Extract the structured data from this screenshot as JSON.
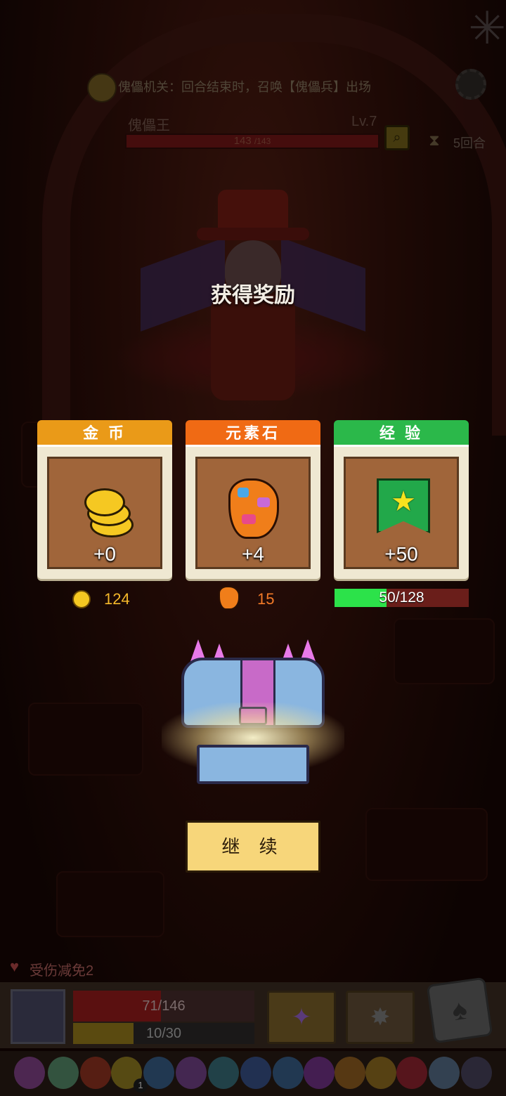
{
  "top": {
    "passive_text": "傀儡机关：回合结束时，召唤【傀儡兵】出场",
    "boss_name": "傀儡王",
    "boss_level": "Lv.7",
    "boss_hp_current": "143",
    "boss_hp_max": "/143",
    "round_text": "5回合"
  },
  "reward": {
    "title": "获得奖励",
    "cards": [
      {
        "label": "金 币",
        "amount": "+0",
        "color": "#ea9a18"
      },
      {
        "label": "元素石",
        "amount": "+4",
        "color": "#f06a14"
      },
      {
        "label": "经 验",
        "amount": "+50",
        "color": "#2bb84a"
      }
    ],
    "gold_total": "124",
    "stone_total": "15",
    "exp_text": "50/128",
    "exp_fraction": 0.39,
    "continue_label": "继 续"
  },
  "player": {
    "shield_text": "受伤减免2",
    "hp_text": "71/146",
    "hp_fraction": 0.486,
    "sp_text": "10/30",
    "sp_fraction": 0.333,
    "item_badge": "1"
  },
  "icons": [
    "cobweb-icon",
    "gear-icon",
    "magnify-icon",
    "round-hourglass-icon",
    "coin-icon",
    "element-stone-icon",
    "exp-flag-icon",
    "star-icon",
    "treasure-chest-icon",
    "shield-icon",
    "dice-icon"
  ]
}
